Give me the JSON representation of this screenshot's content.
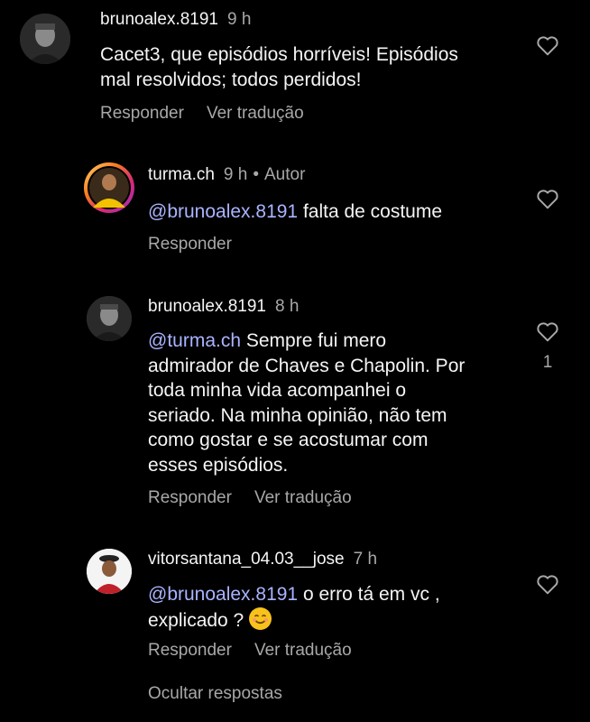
{
  "comments": [
    {
      "username": "brunoalex.8191",
      "time": "9 h",
      "lines": [
        "Cacet3, que episódios horríveis! Episódios",
        "mal resolvidos; todos perdidos!"
      ],
      "actions": [
        "Responder",
        "Ver tradução"
      ]
    },
    {
      "username": "turma.ch",
      "time": "9 h",
      "separator": "•",
      "author_badge": "Autor",
      "mention": "@brunoalex.8191",
      "text": " falta de costume",
      "actions": [
        "Responder"
      ]
    },
    {
      "username": "brunoalex.8191",
      "time": "8 h",
      "mention": "@turma.ch",
      "lines": [
        " Sempre fui mero",
        "admirador de Chaves e Chapolin. Por",
        "toda minha vida acompanhei o",
        "seriado. Na minha opinião, não tem",
        "como gostar e se acostumar com",
        "esses episódios."
      ],
      "like_count": "1",
      "actions": [
        "Responder",
        "Ver tradução"
      ]
    },
    {
      "username": "vitorsantana_04.03__jose",
      "time": "7 h",
      "mention": "@brunoalex.8191",
      "line1_rest": " o erro tá em vc ,",
      "line2": "explicado ? ",
      "actions": [
        "Responder",
        "Ver tradução"
      ]
    }
  ],
  "hide_replies": "Ocultar respostas",
  "colors": {
    "background": "#000000",
    "mention": "#a9b4ff",
    "secondary_text": "#a8a8a8",
    "primary_text": "#f5f5f5"
  },
  "icons": {
    "like": "heart-outline-icon",
    "emoji": "smiling-face-emoji"
  }
}
